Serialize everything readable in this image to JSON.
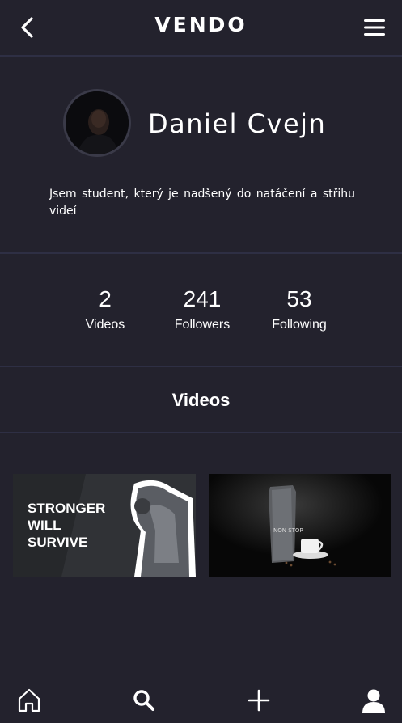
{
  "header": {
    "logo": "VENDO",
    "back_icon": "chevron-left-icon",
    "menu_icon": "hamburger-menu-icon"
  },
  "profile": {
    "name": "Daniel Cvejn",
    "bio": "Jsem student, který je nadšený do natáčení a střihu videí"
  },
  "stats": [
    {
      "value": "2",
      "label": "Videos"
    },
    {
      "value": "241",
      "label": "Followers"
    },
    {
      "value": "53",
      "label": "Following"
    }
  ],
  "videos_section": {
    "title": "Videos",
    "items": [
      {
        "overlay_text": "STRONGER WILL SURVIVE"
      },
      {
        "overlay_text": "NON STOP"
      }
    ]
  },
  "tabbar": {
    "items": [
      {
        "icon": "home-icon"
      },
      {
        "icon": "search-icon"
      },
      {
        "icon": "plus-icon"
      },
      {
        "icon": "user-icon"
      }
    ]
  },
  "colors": {
    "background": "#23222d",
    "divider": "#2e2f44",
    "text": "#ffffff"
  }
}
